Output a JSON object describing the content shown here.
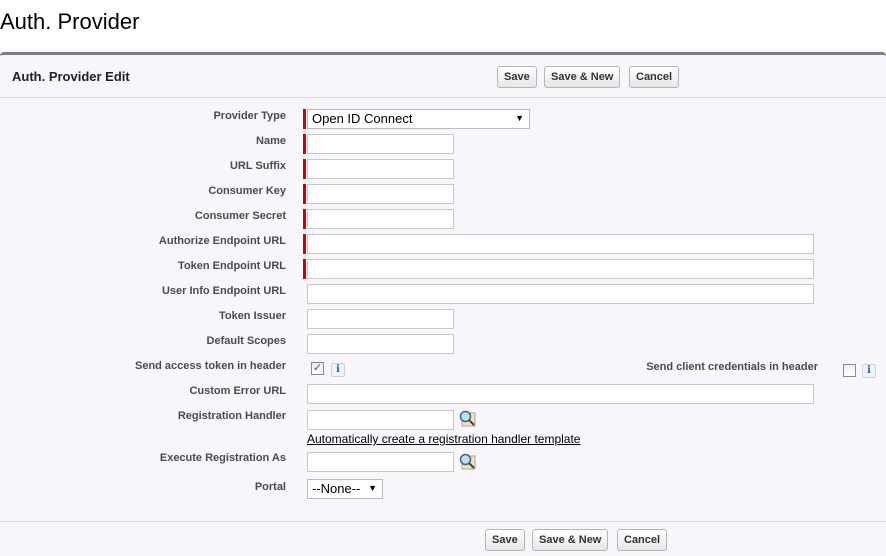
{
  "page_title": "Auth. Provider",
  "panel_title": "Auth. Provider Edit",
  "buttons": {
    "save": "Save",
    "save_new": "Save & New",
    "cancel": "Cancel"
  },
  "fields": {
    "provider_type": {
      "label": "Provider Type",
      "value": "Open ID Connect"
    },
    "name": {
      "label": "Name",
      "value": ""
    },
    "url_suffix": {
      "label": "URL Suffix",
      "value": ""
    },
    "consumer_key": {
      "label": "Consumer Key",
      "value": ""
    },
    "consumer_secret": {
      "label": "Consumer Secret",
      "value": ""
    },
    "authorize_endpoint": {
      "label": "Authorize Endpoint URL",
      "value": ""
    },
    "token_endpoint": {
      "label": "Token Endpoint URL",
      "value": ""
    },
    "user_info_endpoint": {
      "label": "User Info Endpoint URL",
      "value": ""
    },
    "token_issuer": {
      "label": "Token Issuer",
      "value": ""
    },
    "default_scopes": {
      "label": "Default Scopes",
      "value": ""
    },
    "send_token_header": {
      "label": "Send access token in header",
      "checked": true
    },
    "send_client_creds": {
      "label": "Send client credentials in header",
      "checked": false
    },
    "custom_error_url": {
      "label": "Custom Error URL",
      "value": ""
    },
    "registration_handler": {
      "label": "Registration Handler",
      "value": "",
      "link": "Automatically create a registration handler template"
    },
    "execute_as": {
      "label": "Execute Registration As",
      "value": ""
    },
    "portal": {
      "label": "Portal",
      "value": "--None--"
    }
  },
  "info_icon": "i"
}
